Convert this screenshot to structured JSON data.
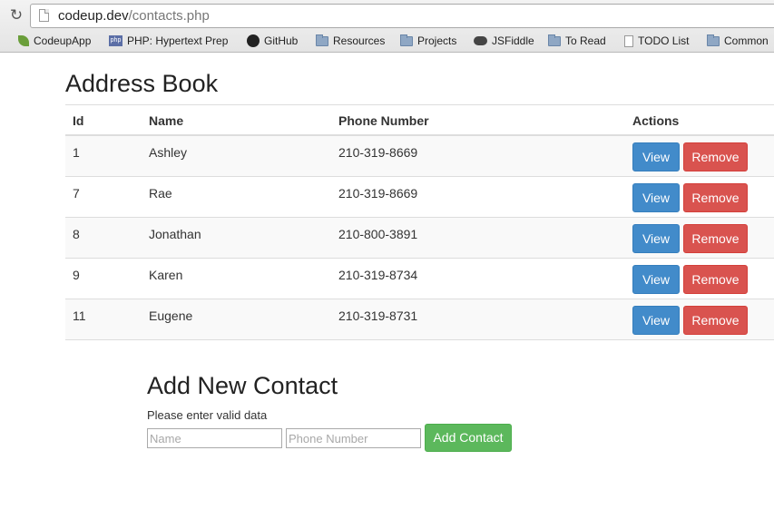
{
  "browser": {
    "url_host": "codeup.dev",
    "url_path": "/contacts.php",
    "bookmarks": [
      {
        "label": "CodeupApp",
        "icon": "leaf-icon"
      },
      {
        "label": "PHP: Hypertext Prep",
        "icon": "php-icon"
      },
      {
        "label": "GitHub",
        "icon": "github-icon"
      },
      {
        "label": "Resources",
        "icon": "folder-icon"
      },
      {
        "label": "Projects",
        "icon": "folder-icon"
      },
      {
        "label": "JSFiddle",
        "icon": "jsfiddle-icon"
      },
      {
        "label": "To Read",
        "icon": "folder-icon"
      },
      {
        "label": "TODO List",
        "icon": "page-icon"
      },
      {
        "label": "Common",
        "icon": "folder-icon"
      }
    ]
  },
  "page": {
    "title": "Address Book",
    "table": {
      "headers": {
        "id": "Id",
        "name": "Name",
        "phone": "Phone Number",
        "actions": "Actions"
      },
      "rows": [
        {
          "id": "1",
          "name": "Ashley",
          "phone": "210-319-8669"
        },
        {
          "id": "7",
          "name": "Rae",
          "phone": "210-319-8669"
        },
        {
          "id": "8",
          "name": "Jonathan",
          "phone": "210-800-3891"
        },
        {
          "id": "9",
          "name": "Karen",
          "phone": "210-319-8734"
        },
        {
          "id": "11",
          "name": "Eugene",
          "phone": "210-319-8731"
        }
      ],
      "view_label": "View",
      "remove_label": "Remove"
    },
    "form": {
      "title": "Add New Contact",
      "note": "Please enter valid data",
      "name_placeholder": "Name",
      "phone_placeholder": "Phone Number",
      "submit_label": "Add Contact"
    }
  },
  "colors": {
    "view_button": "#428bca",
    "remove_button": "#d9534f",
    "add_button": "#5cb85c"
  }
}
